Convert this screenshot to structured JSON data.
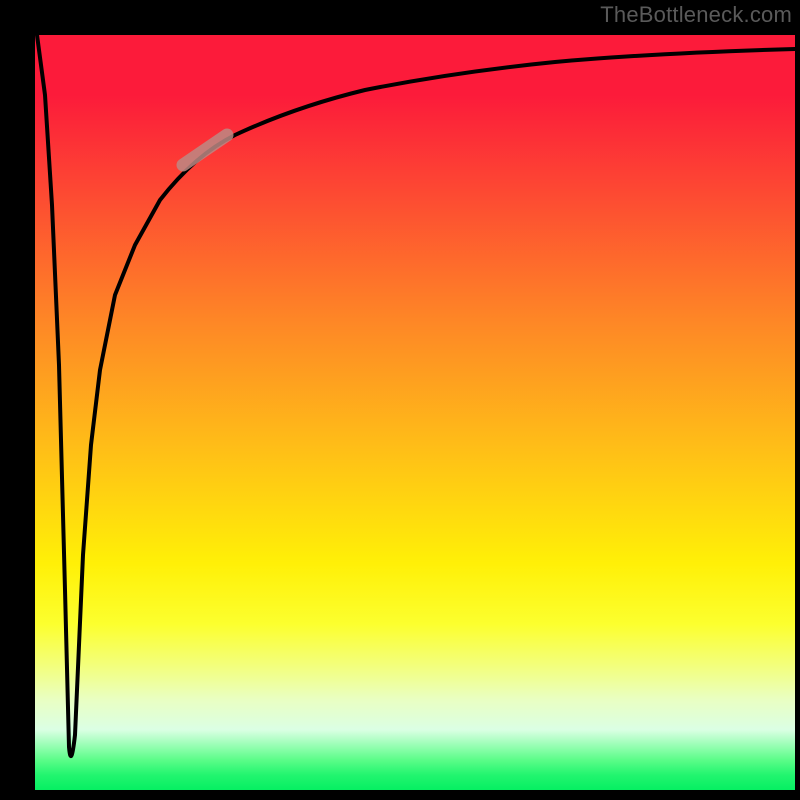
{
  "watermark": "TheBottleneck.com",
  "colors": {
    "frame": "#000000",
    "curve": "#000000",
    "marker": "#bd8984",
    "gradient_stops": [
      "#fc1b3a",
      "#fd4633",
      "#fe8726",
      "#ffbf17",
      "#fff007",
      "#fcff2e",
      "#f2ff83",
      "#e9ffc2",
      "#dbffe4",
      "#5cfd89",
      "#22f56f",
      "#06ef62"
    ]
  },
  "chart_data": {
    "type": "line",
    "title": "",
    "xlabel": "",
    "ylabel": "",
    "xlim": [
      0,
      100
    ],
    "ylim": [
      0,
      100
    ],
    "note": "Axes are unlabeled; x/y are normalized 0–100. Curve starts near top-left, plunges to a sharp minimum near x≈4.5, then recovers along an asymptotic curve toward y≈98 at the right edge.",
    "series": [
      {
        "name": "curve",
        "x": [
          0.0,
          1.0,
          2.0,
          3.0,
          4.0,
          4.5,
          5.0,
          6.0,
          7.0,
          8.0,
          10.0,
          12.0,
          15.0,
          18.0,
          22.0,
          26.0,
          32.0,
          40.0,
          50.0,
          62.0,
          76.0,
          88.0,
          100.0
        ],
        "y": [
          100.0,
          90.0,
          70.0,
          45.0,
          18.0,
          6.0,
          15.0,
          35.0,
          48.0,
          56.0,
          66.0,
          72.0,
          78.0,
          82.0,
          86.0,
          88.5,
          91.0,
          93.0,
          94.7,
          96.0,
          97.0,
          97.6,
          98.0
        ]
      }
    ],
    "marker": {
      "description": "short thick pale segment on the rising part of the curve",
      "x_range": [
        20.0,
        25.0
      ],
      "y_range": [
        84.0,
        88.0
      ]
    }
  }
}
